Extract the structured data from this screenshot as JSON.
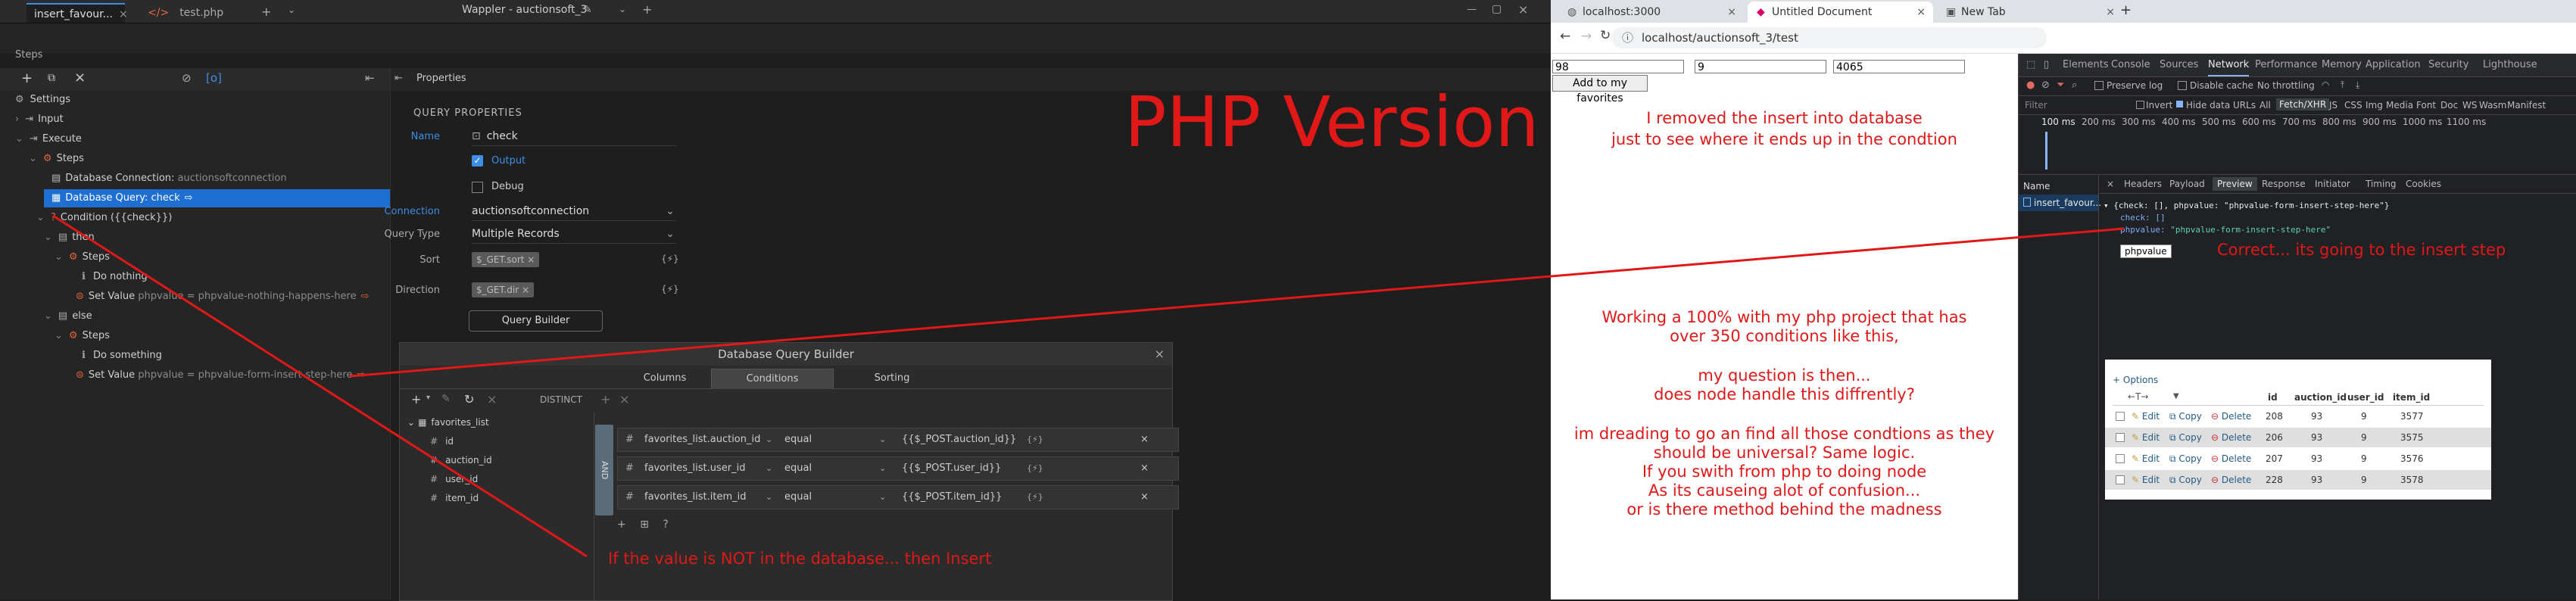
{
  "wappler": {
    "tabs": [
      {
        "label": "insert_favour..."
      },
      {
        "label": "test.php"
      }
    ],
    "window_title": "Wappler - auctionsoft_3",
    "panel_title": "Steps",
    "properties_title": "Properties",
    "tree": [
      {
        "label": "Settings"
      },
      {
        "label": "Input"
      },
      {
        "label": "Execute"
      },
      {
        "label": "Steps"
      },
      {
        "label": "Database Connection:",
        "detail": "auctionsoftconnection"
      },
      {
        "label": "Database Query: check"
      },
      {
        "label": "Condition ({{check}})"
      },
      {
        "label": "then"
      },
      {
        "label": "Steps"
      },
      {
        "label": "Do nothing"
      },
      {
        "label": "Set Value",
        "detail": "phpvalue = phpvalue-nothing-happens-here"
      },
      {
        "label": "else"
      },
      {
        "label": "Steps"
      },
      {
        "label": "Do something"
      },
      {
        "label": "Set Value",
        "detail": "phpvalue = phpvalue-form-insert-step-here"
      }
    ],
    "query_properties": {
      "section": "QUERY PROPERTIES",
      "name_label": "Name",
      "name_value": "check",
      "output_label": "Output",
      "debug_label": "Debug",
      "connection_label": "Connection",
      "connection_value": "auctionsoftconnection",
      "query_type_label": "Query Type",
      "query_type_value": "Multiple Records",
      "sort_label": "Sort",
      "sort_value": "$_GET.sort",
      "direction_label": "Direction",
      "direction_value": "$_GET.dir",
      "query_builder_button": "Query Builder"
    },
    "dqb": {
      "title": "Database Query Builder",
      "tabs": [
        "Columns",
        "Conditions",
        "Sorting"
      ],
      "distinct": "DISTINCT",
      "table": "favorites_list",
      "fields": [
        "id",
        "auction_id",
        "user_id",
        "item_id"
      ],
      "and_label": "AND",
      "conditions": [
        {
          "field": "favorites_list.auction_id",
          "op": "equal",
          "value": "{{$_POST.auction_id}}"
        },
        {
          "field": "favorites_list.user_id",
          "op": "equal",
          "value": "{{$_POST.user_id}}"
        },
        {
          "field": "favorites_list.item_id",
          "op": "equal",
          "value": "{{$_POST.item_id}}"
        }
      ]
    },
    "php_title": "PHP Version",
    "annotation_insert": "If the value is NOT in the database...  then Insert"
  },
  "browser": {
    "tabs": [
      {
        "label": "localhost:3000"
      },
      {
        "label": "Untitled Document"
      },
      {
        "label": "New Tab"
      }
    ],
    "url": "localhost/auctionsoft_3/test",
    "form": {
      "field1": "98",
      "field2": "9",
      "field3": "4065",
      "button": "Add to my favorites"
    },
    "note1": [
      "I removed the insert into database",
      "just to see where it ends up in the condtion"
    ],
    "note2": [
      "Working a 100% with my php project that has",
      "over 350 conditions like this,",
      "",
      "my question is then...",
      "does node handle this diffrently?",
      "",
      "im dreading to go an find all those condtions as they",
      "should be universal? Same logic.",
      "If you swith from php to doing node",
      "As its causeing alot of confusion...",
      "or is there method behind the madness"
    ],
    "devtools": {
      "tabs": [
        "Elements",
        "Console",
        "Sources",
        "Network",
        "Performance",
        "Memory",
        "Application",
        "Security",
        "Lighthouse"
      ],
      "preserve_log": "Preserve log",
      "disable_cache": "Disable cache",
      "throttling": "No throttling",
      "filter_placeholder": "Filter",
      "filter_options": [
        "Invert",
        "Hide data URLs",
        "All",
        "Fetch/XHR",
        "JS",
        "CSS",
        "Img",
        "Media",
        "Font",
        "Doc",
        "WS",
        "Wasm",
        "Manifest"
      ],
      "timeline": [
        "100 ms",
        "200 ms",
        "300 ms",
        "400 ms",
        "500 ms",
        "600 ms",
        "700 ms",
        "800 ms",
        "900 ms",
        "1000 ms",
        "1100 ms"
      ],
      "name_header": "Name",
      "request": "insert_favour...",
      "detail_tabs": [
        "Headers",
        "Payload",
        "Preview",
        "Response",
        "Initiator",
        "Timing",
        "Cookies"
      ],
      "preview_line1": "{check: [], phpvalue: \"phpvalue-form-insert-step-here\"}",
      "preview_line2": "check: []",
      "preview_line3_key": "phpvalue:",
      "preview_line3_val": "\"phpvalue-form-insert-step-here\"",
      "tooltip": "phpvalue"
    },
    "annotation_correct": "Correct... its going to the insert step",
    "db_table": {
      "options": "+ Options",
      "headers": [
        "id",
        "auction_id",
        "user_id",
        "item_id"
      ],
      "actions": [
        "Edit",
        "Copy",
        "Delete"
      ],
      "rows": [
        {
          "id": "208",
          "auction_id": "93",
          "user_id": "9",
          "item_id": "3577"
        },
        {
          "id": "206",
          "auction_id": "93",
          "user_id": "9",
          "item_id": "3575"
        },
        {
          "id": "207",
          "auction_id": "93",
          "user_id": "9",
          "item_id": "3576"
        },
        {
          "id": "228",
          "auction_id": "93",
          "user_id": "9",
          "item_id": "3578"
        }
      ]
    }
  },
  "colors": {
    "annotation": "#e01818",
    "selection": "#1e6fd1",
    "accent": "#3d8ee6"
  }
}
